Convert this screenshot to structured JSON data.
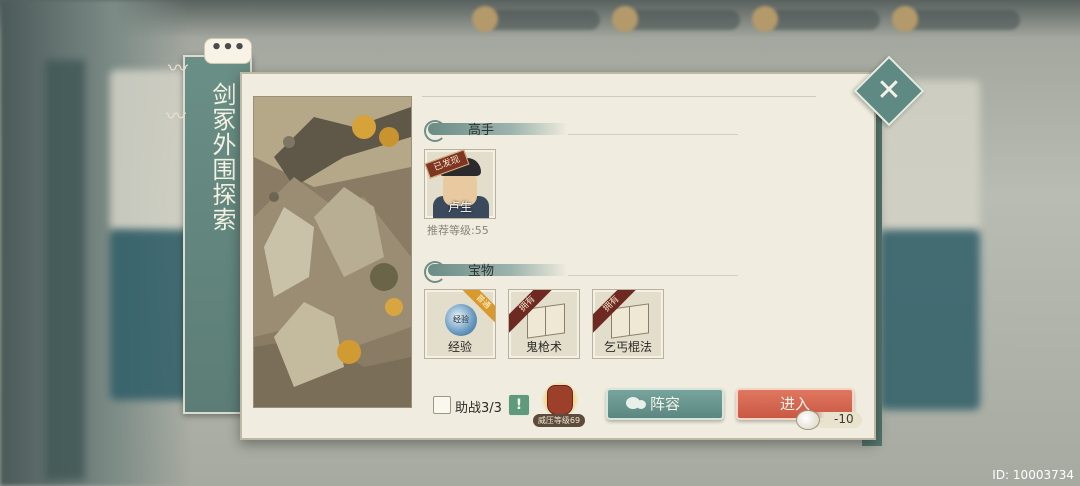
{
  "stage": {
    "title": "剑冢外围探索"
  },
  "sections": {
    "masters": {
      "title": "高手",
      "heroes": [
        {
          "name": "卢生",
          "badge": "已发现"
        }
      ],
      "recommended_level": "推荐等级:55"
    },
    "treasures": {
      "title": "宝物",
      "items": [
        {
          "label": "经验",
          "tag": "普通",
          "icon_text": "经验",
          "icon": "experience-orb-icon"
        },
        {
          "label": "鬼枪术",
          "tag": "拥有",
          "icon": "martial-book-icon"
        },
        {
          "label": "乞丐棍法",
          "tag": "拥有",
          "icon": "martial-book-icon"
        }
      ]
    }
  },
  "footer": {
    "assist_label": "助战3/3",
    "info_symbol": "!",
    "suppress_label": "威压等级69",
    "lineup_button": "阵容",
    "enter_button": "进入",
    "cost": "-10"
  },
  "overlay": {
    "chat_dots": "•••",
    "close_symbol": "✕"
  },
  "watermark": {
    "id_text": "ID: 10003734"
  }
}
